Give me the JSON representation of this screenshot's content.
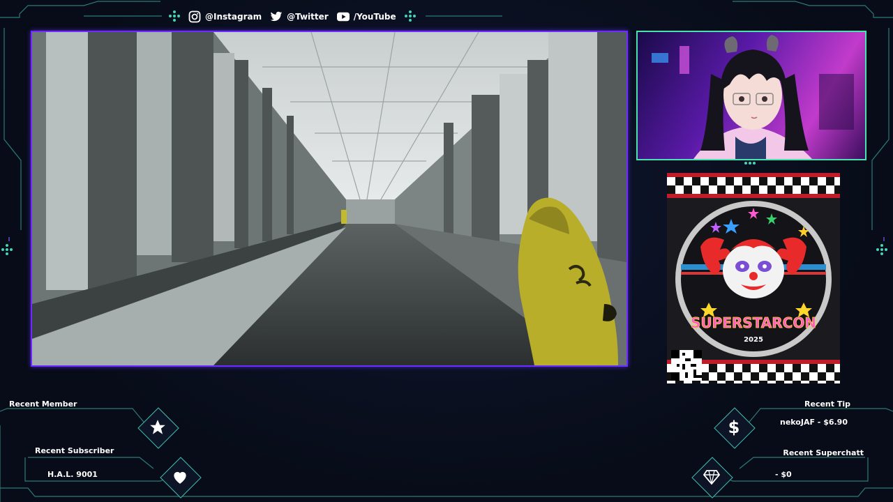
{
  "social": {
    "instagram": "@Instagram",
    "twitter": "@Twitter",
    "youtube": "/YouTube"
  },
  "ad": {
    "title": "SUPERSTARCON",
    "year": "2025"
  },
  "widgets": {
    "recent_member_label": "Recent Member",
    "recent_member_value": "",
    "recent_subscriber_label": "Recent Subscriber",
    "recent_subscriber_value": "H.A.L. 9001",
    "recent_tip_label": "Recent Tip",
    "recent_tip_value": "nekoJAF - $6.90",
    "recent_superchat_label": "Recent Superchatt",
    "recent_superchat_value": "- $0"
  },
  "colors": {
    "game_border": "#6a2cff",
    "cam_border": "#49e3b0",
    "hud_line": "#3fbfb0",
    "ad_red": "#c01d2a"
  }
}
